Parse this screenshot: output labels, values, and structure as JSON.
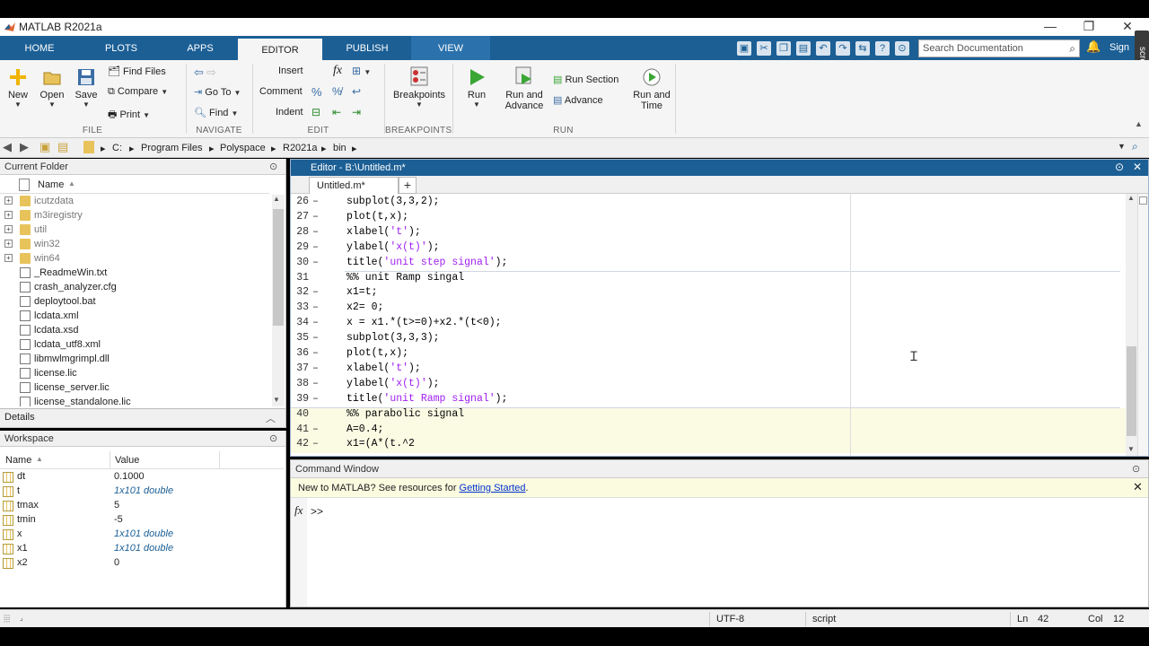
{
  "window": {
    "title": "MATLAB R2021a",
    "controls": [
      "—",
      "❐",
      "✕"
    ]
  },
  "ribbon_tabs": [
    {
      "label": "HOME"
    },
    {
      "label": "PLOTS"
    },
    {
      "label": "APPS"
    },
    {
      "label": "EDITOR",
      "active": true
    },
    {
      "label": "PUBLISH"
    },
    {
      "label": "VIEW"
    }
  ],
  "search": {
    "placeholder": "Search Documentation"
  },
  "signin": "Sign",
  "screencast": "screencast",
  "ribbon": {
    "file": {
      "section": "FILE",
      "new": "New",
      "open": "Open",
      "save": "Save",
      "find_files": "Find Files",
      "compare": "Compare",
      "print": "Print"
    },
    "navigate": {
      "section": "NAVIGATE",
      "go_to": "Go To",
      "find": "Find"
    },
    "edit": {
      "section": "EDIT",
      "insert": "Insert",
      "comment": "Comment",
      "indent": "Indent",
      "fx": "fx"
    },
    "breakpoints": {
      "section": "BREAKPOINTS",
      "label": "Breakpoints"
    },
    "run": {
      "section": "RUN",
      "run": "Run",
      "run_and": "Run and",
      "advance": "Advance",
      "run_section": "Run Section",
      "advance_btn": "Advance",
      "run_and_time_1": "Run and",
      "run_and_time_2": "Time"
    }
  },
  "address": {
    "crumbs": [
      "C:",
      "Program Files",
      "Polyspace",
      "R2021a",
      "bin"
    ]
  },
  "current_folder": {
    "title": "Current Folder",
    "column": "Name",
    "items": [
      {
        "name": "icutzdata",
        "type": "folder",
        "dim": true
      },
      {
        "name": "m3iregistry",
        "type": "folder",
        "dim": true
      },
      {
        "name": "util",
        "type": "folder",
        "dim": true
      },
      {
        "name": "win32",
        "type": "folder",
        "dim": true
      },
      {
        "name": "win64",
        "type": "folder",
        "dim": true
      },
      {
        "name": "_ReadmeWin.txt",
        "type": "file"
      },
      {
        "name": "crash_analyzer.cfg",
        "type": "file"
      },
      {
        "name": "deploytool.bat",
        "type": "file"
      },
      {
        "name": "lcdata.xml",
        "type": "file"
      },
      {
        "name": "lcdata.xsd",
        "type": "file"
      },
      {
        "name": "lcdata_utf8.xml",
        "type": "file"
      },
      {
        "name": "libmwlmgrimpl.dll",
        "type": "file"
      },
      {
        "name": "license.lic",
        "type": "file"
      },
      {
        "name": "license_server.lic",
        "type": "file"
      },
      {
        "name": "license_standalone.lic",
        "type": "file"
      }
    ]
  },
  "details": {
    "title": "Details"
  },
  "workspace": {
    "title": "Workspace",
    "columns": [
      "Name",
      "Value"
    ],
    "vars": [
      {
        "name": "dt",
        "value": "0.1000",
        "italic": false
      },
      {
        "name": "t",
        "value": "1x101 double",
        "italic": true
      },
      {
        "name": "tmax",
        "value": "5",
        "italic": false
      },
      {
        "name": "tmin",
        "value": "-5",
        "italic": false
      },
      {
        "name": "x",
        "value": "1x101 double",
        "italic": true
      },
      {
        "name": "x1",
        "value": "1x101 double",
        "italic": true
      },
      {
        "name": "x2",
        "value": "0",
        "italic": false
      }
    ]
  },
  "editor": {
    "title": "Editor - B:\\Untitled.m*",
    "tab": "Untitled.m*",
    "lines": [
      {
        "n": "26",
        "code": "subplot(3,3,2);"
      },
      {
        "n": "27",
        "code": "plot(t,x);"
      },
      {
        "n": "28",
        "code": "xlabel('t');"
      },
      {
        "n": "29",
        "code": "ylabel('x(t)');"
      },
      {
        "n": "30",
        "code": "title('unit step signal');"
      },
      {
        "n": "31",
        "code": "%% unit Ramp singal"
      },
      {
        "n": "32",
        "code": "x1=t;"
      },
      {
        "n": "33",
        "code": "x2= 0;"
      },
      {
        "n": "34",
        "code": "x = x1.*(t>=0)+x2.*(t<0);"
      },
      {
        "n": "35",
        "code": "subplot(3,3,3);"
      },
      {
        "n": "36",
        "code": "plot(t,x);"
      },
      {
        "n": "37",
        "code": "xlabel('t');"
      },
      {
        "n": "38",
        "code": "ylabel('x(t)');"
      },
      {
        "n": "39",
        "code": "title('unit Ramp signal');"
      },
      {
        "n": "40",
        "code": "%% parabolic signal"
      },
      {
        "n": "41",
        "code": "A=0.4;"
      },
      {
        "n": "42",
        "code": "x1=(A*(t.^2"
      }
    ]
  },
  "command_window": {
    "title": "Command Window",
    "notice_text": "New to MATLAB? See resources for ",
    "notice_link": "Getting Started",
    "notice_end": ".",
    "prompt": ">>",
    "fx": "fx"
  },
  "status": {
    "encoding": "UTF-8",
    "type": "script",
    "ln_label": "Ln",
    "ln": "42",
    "col_label": "Col",
    "col": "12"
  }
}
